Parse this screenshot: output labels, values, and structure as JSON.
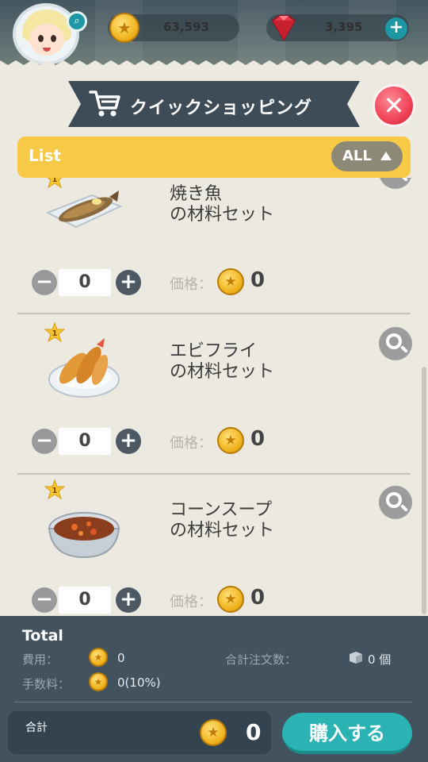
{
  "hud": {
    "coins": "63,593",
    "gems": "3,395",
    "avatar_badge_icon": "search-icon",
    "gem_add_icon": "plus-icon"
  },
  "header": {
    "title": "クイックショッピング",
    "cart_icon": "cart-icon",
    "close_icon": "close-icon"
  },
  "list_bar": {
    "label": "List",
    "filter_label": "ALL"
  },
  "items": [
    {
      "name_line1": "焼き魚",
      "name_line2": "の材料セット",
      "quantity": "0",
      "price_label": "価格：",
      "price": "0",
      "star_level": "1"
    },
    {
      "name_line1": "エビフライ",
      "name_line2": "の材料セット",
      "quantity": "0",
      "price_label": "価格：",
      "price": "0",
      "star_level": "1"
    },
    {
      "name_line1": "コーンスープ",
      "name_line2": "の材料セット",
      "quantity": "0",
      "price_label": "価格：",
      "price": "0",
      "star_level": "1"
    }
  ],
  "footer": {
    "title": "Total",
    "cost_label": "費用：",
    "cost_value": "0",
    "fee_label": "手数料：",
    "fee_value": "0(10%)",
    "order_count_label": "合計注文数：",
    "order_count_value": "0 個",
    "sum_label": "合計",
    "sum_value": "0",
    "buy_label": "購入する"
  },
  "colors": {
    "accent_teal": "#2bb3b3",
    "list_yellow": "#f8c947",
    "close_red": "#f04256",
    "footer_navy": "#42525f"
  }
}
